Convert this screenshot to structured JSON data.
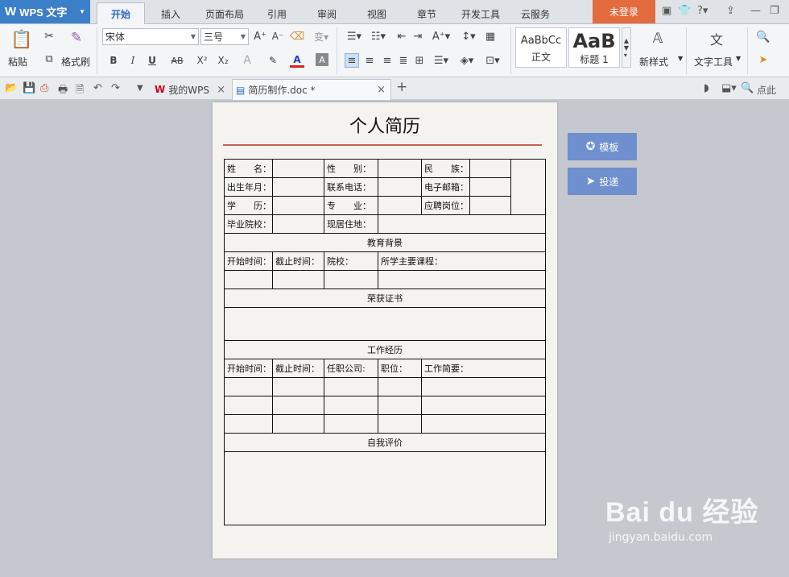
{
  "app": {
    "name": "WPS 文字"
  },
  "menu": {
    "tabs": [
      "开始",
      "插入",
      "页面布局",
      "引用",
      "审阅",
      "视图",
      "章节",
      "开发工具",
      "云服务"
    ],
    "active_tab": "开始",
    "login_label": "未登录"
  },
  "ribbon": {
    "paste_label": "粘贴",
    "format_painter_label": "格式刷",
    "font_name": "宋体",
    "font_size": "三号",
    "style_normal_preview": "AaBbCc",
    "style_normal_label": "正文",
    "style_heading_preview": "AaB",
    "style_heading_label": "标题 1",
    "new_style_label": "新样式",
    "text_tools_label": "文字工具",
    "find_label": "点",
    "bold": "B",
    "italic": "I",
    "underline": "U",
    "strike": "AB",
    "superscript": "X²",
    "subscript": "X₂"
  },
  "doc_tabs": [
    {
      "label": "我的WPS"
    },
    {
      "label": "简历制作.doc *"
    }
  ],
  "quick_access": {
    "find_text": "点此"
  },
  "document": {
    "title": "个人简历",
    "rows": {
      "r1": [
        "姓　　名：",
        "",
        "性　　别：",
        "",
        "民　　族：",
        "",
        ""
      ],
      "r2": [
        "出生年月：",
        "",
        "联系电话：",
        "",
        "电子邮箱：",
        ""
      ],
      "r3": [
        "学　　历：",
        "",
        "专　　业：",
        "",
        "应聘岗位：",
        ""
      ],
      "r4": [
        "毕业院校：",
        "",
        "现居住地：",
        ""
      ],
      "edu_header": "教育背景",
      "edu_cols": [
        "开始时间：",
        "截止时间：",
        "院校：",
        "所学主要课程："
      ],
      "cert_header": "荣获证书",
      "work_header": "工作经历",
      "work_cols": [
        "开始时间：",
        "截止时间：",
        "任职公司:",
        "职位：",
        "工作简要："
      ],
      "eval_header": "自我评价"
    }
  },
  "side_panel": {
    "template_label": "模板",
    "submit_label": "投递"
  },
  "watermark": {
    "logo": "Bai du 经验",
    "url": "jingyan.baidu.com"
  },
  "colors": {
    "accent_blue": "#3c7fc9",
    "login_orange": "#e46b3e",
    "side_button": "#6f8fce",
    "title_rule": "#c0392b"
  }
}
